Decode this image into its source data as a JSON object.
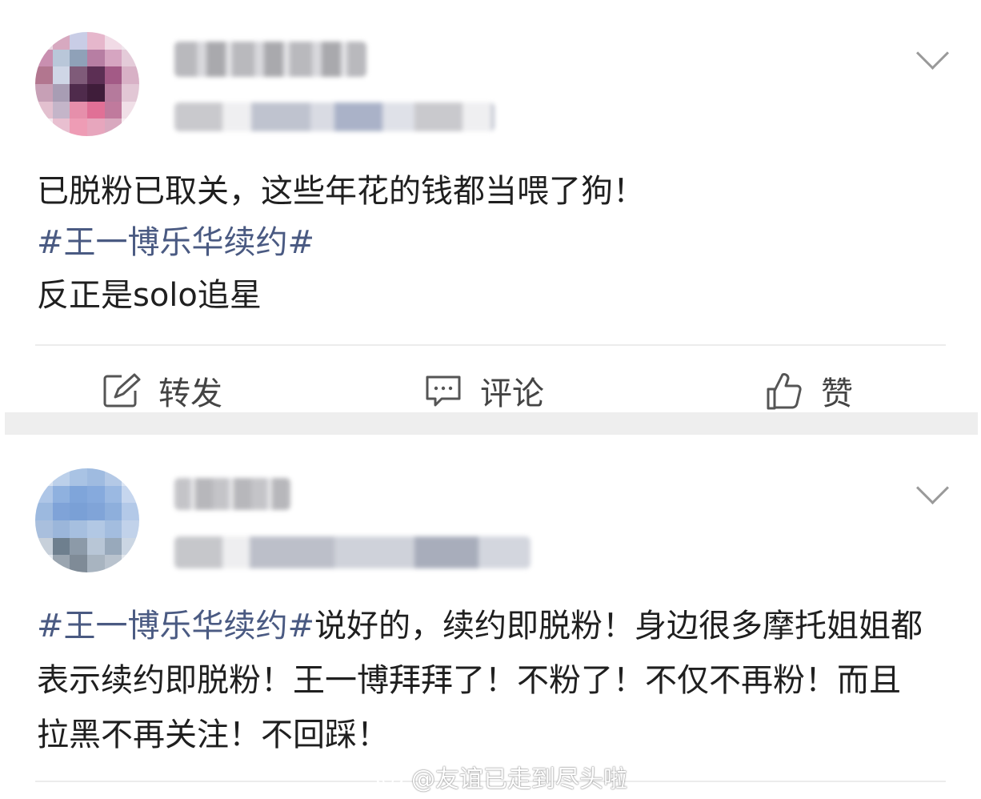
{
  "posts": [
    {
      "username_visible": false,
      "content": {
        "line1": "已脱粉已取关，这些年花的钱都当喂了狗！",
        "topic": "#王一博乐华续约#",
        "line3": "反正是solo追星"
      },
      "actions": {
        "repost": {
          "label": "转发",
          "icon": "repost-icon"
        },
        "comment": {
          "label": "评论",
          "icon": "comment-icon"
        },
        "like": {
          "label": "赞",
          "icon": "thumbs-up-icon"
        }
      }
    },
    {
      "username_visible": false,
      "content": {
        "topic": "#王一博乐华续约#",
        "body": "说好的，续约即脱粉！身边很多摩托姐姐都表示续约即脱粉！王一博拜拜了！不粉了！不仅不再粉！而且拉黑不再关注！不回踩！"
      }
    }
  ],
  "watermark": {
    "text": "@友谊已走到尽头啦",
    "icon": "weibo-logo-icon"
  },
  "colors": {
    "topic": "#4a5a82",
    "text": "#1f1f1f",
    "separator": "#eeeeee"
  }
}
